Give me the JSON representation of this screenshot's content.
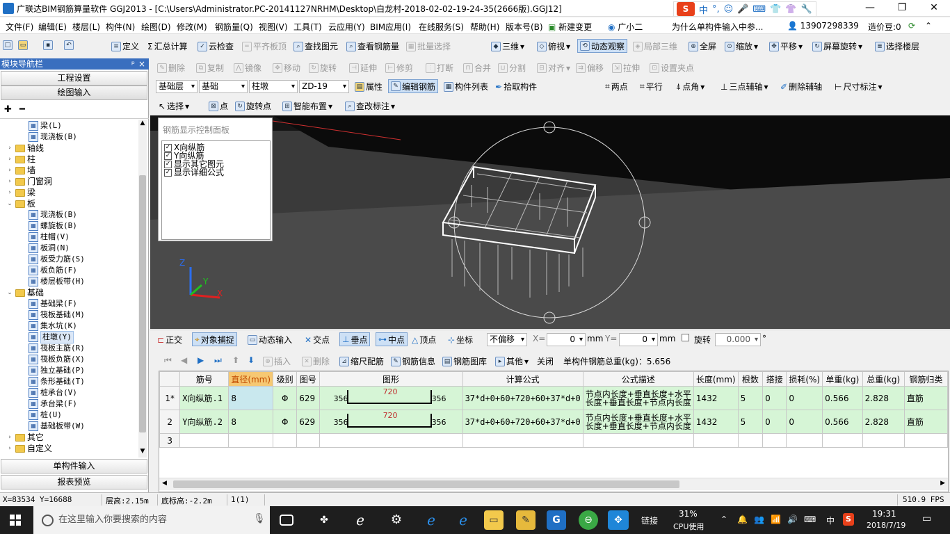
{
  "window": {
    "title": "广联达BIM钢筋算量软件 GGJ2013 - [C:\\Users\\Administrator.PC-20141127NRHM\\Desktop\\白龙村-2018-02-02-19-24-35(2666版).GGJ12]",
    "controls": [
      "—",
      "❐",
      "✕"
    ]
  },
  "ime": {
    "logo": "S",
    "items": [
      "中",
      "°,",
      "☺",
      "🎤",
      "⌨",
      "👕",
      "👚",
      "🔧"
    ]
  },
  "menu": {
    "items": [
      "文件(F)",
      "编辑(E)",
      "楼层(L)",
      "构件(N)",
      "绘图(D)",
      "修改(M)",
      "钢筋量(Q)",
      "视图(V)",
      "工具(T)",
      "云应用(Y)",
      "BIM应用(I)",
      "在线服务(S)",
      "帮助(H)",
      "版本号(B)"
    ],
    "new_change": "新建变更",
    "assistant": "广小二",
    "question": "为什么单构件输入中参...",
    "phone": "13907298339",
    "beans": "造价豆:0"
  },
  "toolbar1": {
    "items": [
      "定义",
      "汇总计算",
      "云检查",
      "平齐板顶",
      "查找图元",
      "查看钢筋量",
      "批量选择",
      "三维",
      "俯视",
      "动态观察",
      "局部三维",
      "全屏",
      "缩放",
      "平移",
      "屏幕旋转",
      "选择楼层"
    ]
  },
  "toolbar2": {
    "items": [
      "删除",
      "复制",
      "镜像",
      "移动",
      "旋转",
      "延伸",
      "修剪",
      "打断",
      "合并",
      "分割",
      "对齐",
      "偏移",
      "拉伸",
      "设置夹点"
    ]
  },
  "toolbar3": {
    "floor": "基础层",
    "category": "基础",
    "type": "柱墩",
    "element": "ZD-19",
    "items": [
      "属性",
      "编辑钢筋",
      "构件列表",
      "拾取构件"
    ],
    "aux": [
      "两点",
      "平行",
      "点角",
      "三点辅轴",
      "删除辅轴",
      "尺寸标注"
    ]
  },
  "toolbar4": {
    "items": [
      "选择",
      "点",
      "旋转点",
      "智能布置",
      "查改标注"
    ]
  },
  "nav": {
    "title": "模块导航栏",
    "pin": "ᵖ",
    "close": "×",
    "top_buttons": [
      "工程设置",
      "绘图输入"
    ],
    "bottom_buttons": [
      "单构件输入",
      "报表预览"
    ],
    "toolbar_icons": [
      "✚",
      "━"
    ],
    "tree": [
      {
        "label": "梁(L)",
        "level": 2,
        "kind": "leaf"
      },
      {
        "label": "现浇板(B)",
        "level": 2,
        "kind": "leaf"
      },
      {
        "label": "轴线",
        "level": 1,
        "kind": "folder",
        "exp": "›"
      },
      {
        "label": "柱",
        "level": 1,
        "kind": "folder",
        "exp": "›"
      },
      {
        "label": "墙",
        "level": 1,
        "kind": "folder",
        "exp": "›"
      },
      {
        "label": "门窗洞",
        "level": 1,
        "kind": "folder",
        "exp": "›"
      },
      {
        "label": "梁",
        "level": 1,
        "kind": "folder",
        "exp": "›"
      },
      {
        "label": "板",
        "level": 1,
        "kind": "folder",
        "exp": "⌄"
      },
      {
        "label": "现浇板(B)",
        "level": 2,
        "kind": "leaf"
      },
      {
        "label": "螺旋板(B)",
        "level": 2,
        "kind": "leaf"
      },
      {
        "label": "柱帽(V)",
        "level": 2,
        "kind": "leaf"
      },
      {
        "label": "板洞(N)",
        "level": 2,
        "kind": "leaf"
      },
      {
        "label": "板受力筋(S)",
        "level": 2,
        "kind": "leaf"
      },
      {
        "label": "板负筋(F)",
        "level": 2,
        "kind": "leaf"
      },
      {
        "label": "楼层板带(H)",
        "level": 2,
        "kind": "leaf"
      },
      {
        "label": "基础",
        "level": 1,
        "kind": "folder",
        "exp": "⌄"
      },
      {
        "label": "基础梁(F)",
        "level": 2,
        "kind": "leaf"
      },
      {
        "label": "筏板基础(M)",
        "level": 2,
        "kind": "leaf"
      },
      {
        "label": "集水坑(K)",
        "level": 2,
        "kind": "leaf"
      },
      {
        "label": "柱墩(Y)",
        "level": 2,
        "kind": "leaf",
        "selected": true
      },
      {
        "label": "筏板主筋(R)",
        "level": 2,
        "kind": "leaf"
      },
      {
        "label": "筏板负筋(X)",
        "level": 2,
        "kind": "leaf"
      },
      {
        "label": "独立基础(P)",
        "level": 2,
        "kind": "leaf"
      },
      {
        "label": "条形基础(T)",
        "level": 2,
        "kind": "leaf"
      },
      {
        "label": "桩承台(V)",
        "level": 2,
        "kind": "leaf"
      },
      {
        "label": "承台梁(F)",
        "level": 2,
        "kind": "leaf"
      },
      {
        "label": "桩(U)",
        "level": 2,
        "kind": "leaf"
      },
      {
        "label": "基础板带(W)",
        "level": 2,
        "kind": "leaf"
      },
      {
        "label": "其它",
        "level": 1,
        "kind": "folder",
        "exp": "›"
      },
      {
        "label": "自定义",
        "level": 1,
        "kind": "folder",
        "exp": "›"
      }
    ]
  },
  "rebar_panel": {
    "title": "钢筋显示控制面板",
    "options": [
      {
        "label": "X向纵筋",
        "checked": true
      },
      {
        "label": "Y向纵筋",
        "checked": true
      },
      {
        "label": "显示其它图元",
        "checked": true
      },
      {
        "label": "显示详细公式",
        "checked": true
      }
    ]
  },
  "axis": {
    "z": "Z",
    "y": "Y",
    "x": "X"
  },
  "snapbar": {
    "items": [
      "正交",
      "对象捕捉",
      "动态输入",
      "交点",
      "垂点",
      "中点",
      "顶点",
      "坐标"
    ],
    "offset_mode": "不偏移",
    "x_label": "X=",
    "x_value": "0",
    "unit1": "mm",
    "y_label": "Y=",
    "y_value": "0",
    "unit2": "mm",
    "rotate_label": "旋转",
    "rotate_value": "0.000",
    "degree": "°"
  },
  "grid_toolbar": {
    "items": [
      "插入",
      "删除",
      "缩尺配筋",
      "钢筋信息",
      "钢筋图库",
      "其他",
      "关闭"
    ],
    "total_label": "单构件钢筋总重(kg)：5.656"
  },
  "grid": {
    "columns": [
      "",
      "筋号",
      "直径(mm)",
      "级别",
      "图号",
      "图形",
      "计算公式",
      "公式描述",
      "长度(mm)",
      "根数",
      "搭接",
      "损耗(%)",
      "单重(kg)",
      "总重(kg)",
      "钢筋归类"
    ],
    "rows": [
      {
        "num": "1*",
        "name": "X向纵筋.1",
        "dia": "8",
        "grade": "Φ",
        "fig": "629",
        "left": "356",
        "mid": "720",
        "right": "356",
        "formula": "37*d+0+60+720+60+37*d+0",
        "desc1": "节点内长度+垂直长度+水平",
        "desc2": "长度+垂直长度+节点内长度",
        "len": "1432",
        "count": "5",
        "lap": "0",
        "loss": "0",
        "unit_w": "0.566",
        "total_w": "2.828",
        "cat": "直筋"
      },
      {
        "num": "2",
        "name": "Y向纵筋.2",
        "dia": "8",
        "grade": "Φ",
        "fig": "629",
        "left": "356",
        "mid": "720",
        "right": "356",
        "formula": "37*d+0+60+720+60+37*d+0",
        "desc1": "节点内长度+垂直长度+水平",
        "desc2": "长度+垂直长度+节点内长度",
        "len": "1432",
        "count": "5",
        "lap": "0",
        "loss": "0",
        "unit_w": "0.566",
        "total_w": "2.828",
        "cat": "直筋"
      }
    ],
    "empty_row": "3"
  },
  "status": {
    "coords": "X=83534 Y=16688",
    "floor_h": "层高:2.15m",
    "base_h": "底标高:-2.2m",
    "count": "1(1)",
    "fps": "510.9 FPS"
  },
  "taskbar": {
    "search_placeholder": "在这里输入你要搜索的内容",
    "link": "链接",
    "cpu_pct": "31%",
    "cpu_label": "CPU使用",
    "lang": "中",
    "time": "19:31",
    "date": "2018/7/19"
  }
}
